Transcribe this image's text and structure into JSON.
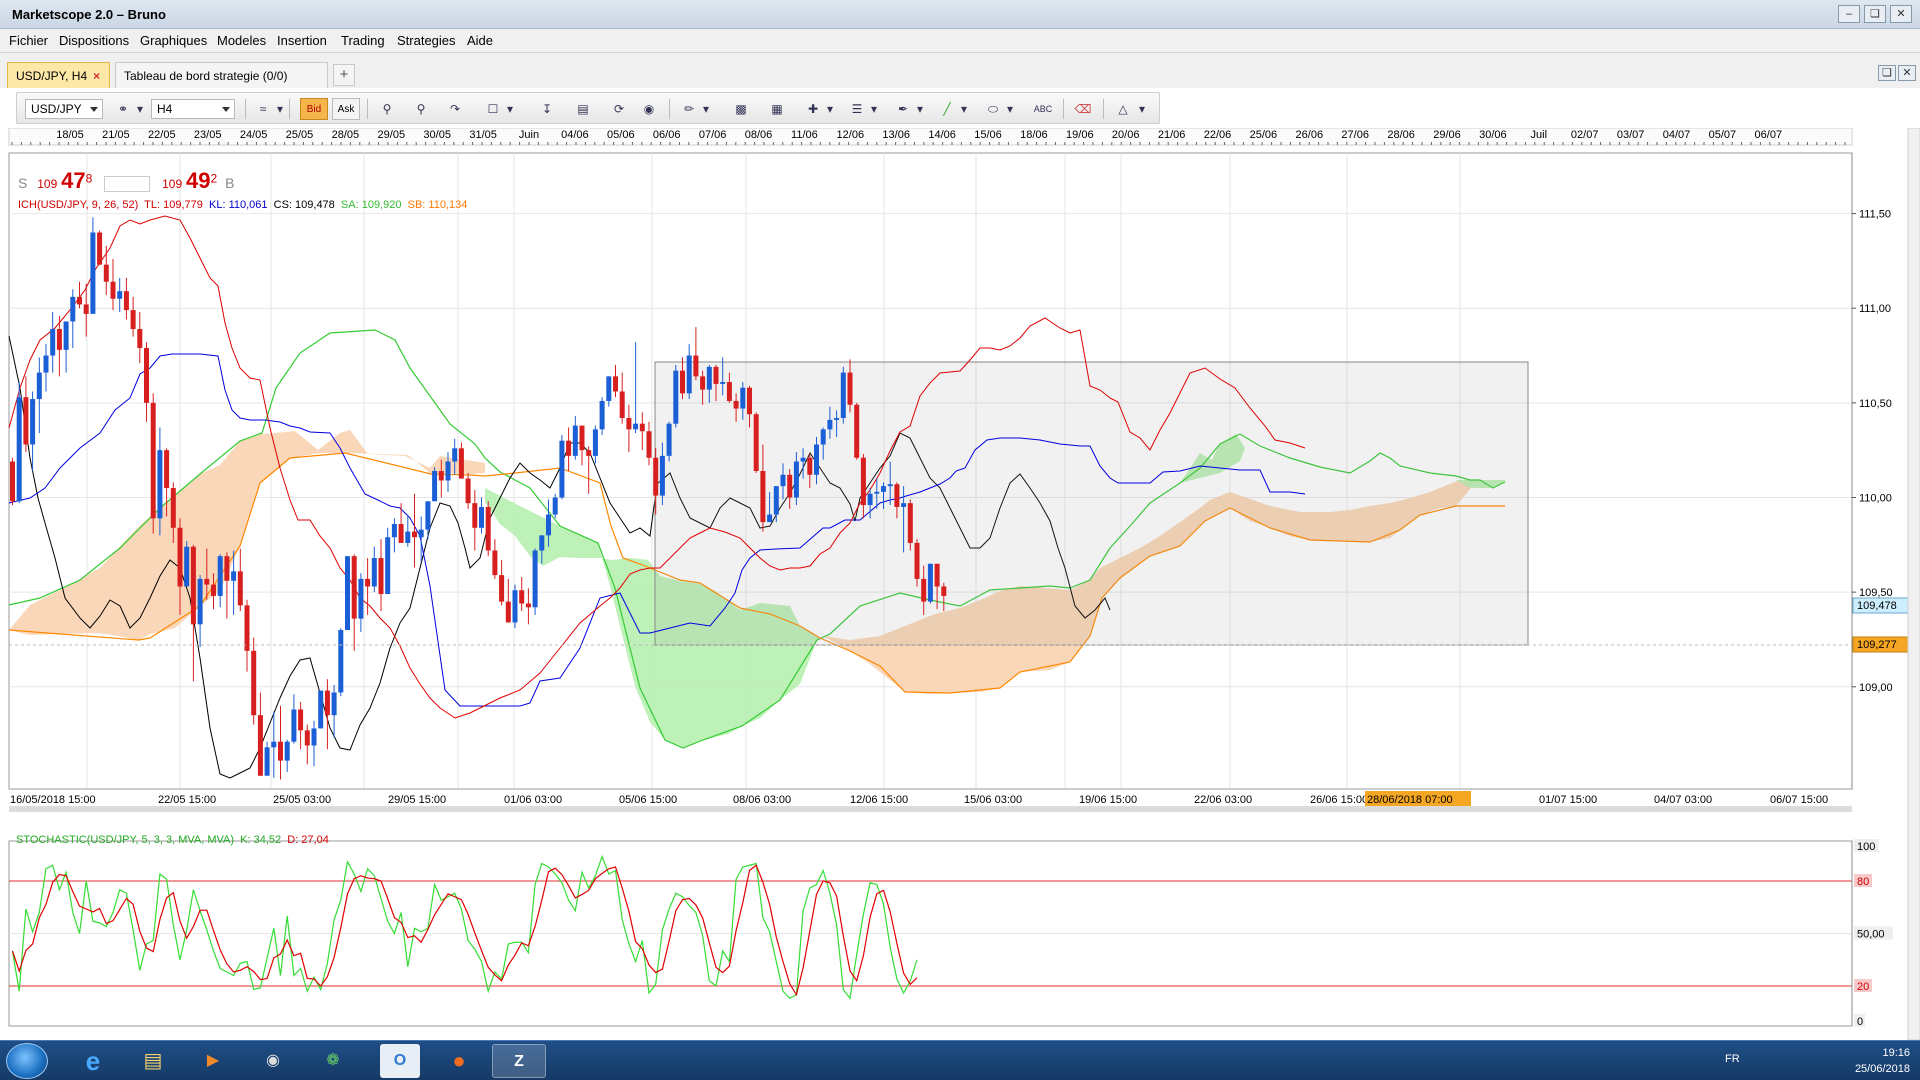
{
  "window": {
    "title": "Marketscope 2.0 – Bruno"
  },
  "menu": [
    "Fichier",
    "Dispositions",
    "Graphiques",
    "Modeles",
    "Insertion",
    "Trading",
    "Strategies",
    "Aide"
  ],
  "tabs": [
    {
      "label": "USD/JPY, H4",
      "active": true
    },
    {
      "label": "Tableau de bord strategie (0/0)",
      "active": false
    }
  ],
  "toolbar": {
    "symbol": "USD/JPY",
    "timeframe": "H4",
    "bid_label": "Bid",
    "ask_label": "Ask"
  },
  "quote": {
    "sell_label": "S",
    "sell_big_prefix": "109",
    "sell_pips": "47",
    "sell_frac": "8",
    "buy_big_prefix": "109",
    "buy_pips": "49",
    "buy_frac": "2",
    "buy_label": "B"
  },
  "ichimoku": {
    "name": "ICH(USD/JPY, 9, 26, 52)",
    "tl": "TL: 109,779",
    "kl": "KL: 110,061",
    "cs": "CS: 109,478",
    "sa": "SA: 109,920",
    "sb": "SB: 110,134",
    "colors": {
      "tenkan": "#e00000",
      "kijun": "#0000e0",
      "chikou": "#000000",
      "senkou_a": "#33cc33",
      "senkou_b": "#ff8800",
      "cloud_bull": "#b7f0b0",
      "cloud_bear": "#fad3b0"
    }
  },
  "stochastic": {
    "name": "STOCHASTIC(USD/JPY, 5, 3, 3, MVA, MVA)",
    "k": "K: 34,52",
    "d": "D: 27,04",
    "colors": {
      "k": "#33dd33",
      "d": "#e00000"
    }
  },
  "top_date_labels": [
    "18/05",
    "21/05",
    "22/05",
    "23/05",
    "24/05",
    "25/05",
    "28/05",
    "29/05",
    "30/05",
    "31/05",
    "Juin",
    "04/06",
    "05/06",
    "06/06",
    "07/06",
    "08/06",
    "11/06",
    "12/06",
    "13/06",
    "14/06",
    "15/06",
    "18/06",
    "19/06",
    "20/06",
    "21/06",
    "22/06",
    "25/06",
    "26/06",
    "27/06",
    "28/06",
    "29/06",
    "30/06",
    "Juil",
    "02/07",
    "03/07",
    "04/07",
    "05/07",
    "06/07"
  ],
  "bottom_date_labels": [
    "16/05/2018 15:00",
    "22/05 15:00",
    "25/05 03:00",
    "29/05 15:00",
    "01/06 03:00",
    "05/06 15:00",
    "08/06 03:00",
    "12/06 15:00",
    "15/06 03:00",
    "19/06 15:00",
    "22/06 03:00",
    "26/06 15:00",
    "28/06/2018 07:00",
    "01/07 15:00",
    "04/07 03:00",
    "06/07 15:00"
  ],
  "price_axis": {
    "labels": [
      "111,50",
      "111,00",
      "110,50",
      "110,00",
      "109,50",
      "109,00"
    ],
    "current_price": "109,478",
    "marker_price": "109,277"
  },
  "stoch_axis": {
    "labels": [
      "100",
      "80",
      "50,00",
      "20",
      "0"
    ]
  },
  "chart_data": {
    "type": "candlestick",
    "price_range": [
      108.46,
      111.82
    ],
    "candles": [
      [
        110.19,
        110.21,
        109.96,
        109.98
      ],
      [
        109.98,
        110.61,
        109.97,
        110.53
      ],
      [
        110.53,
        110.64,
        110.24,
        110.28
      ],
      [
        110.28,
        110.56,
        110.14,
        110.52
      ],
      [
        110.52,
        110.74,
        110.34,
        110.66
      ],
      [
        110.66,
        110.81,
        110.56,
        110.75
      ],
      [
        110.75,
        110.98,
        110.66,
        110.89
      ],
      [
        110.89,
        110.96,
        110.64,
        110.78
      ],
      [
        110.78,
        110.93,
        110.66,
        110.93
      ],
      [
        110.93,
        111.1,
        110.79,
        111.06
      ],
      [
        111.06,
        111.14,
        111.0,
        111.02
      ],
      [
        111.02,
        111.13,
        110.85,
        110.97
      ],
      [
        110.97,
        111.48,
        110.99,
        111.4
      ],
      [
        111.4,
        111.41,
        111.23,
        111.23
      ],
      [
        111.23,
        111.33,
        111.07,
        111.14
      ],
      [
        111.14,
        111.26,
        110.99,
        111.05
      ],
      [
        111.05,
        111.16,
        110.98,
        111.09
      ],
      [
        111.09,
        111.16,
        110.94,
        110.99
      ],
      [
        110.99,
        111.06,
        110.85,
        110.89
      ],
      [
        110.89,
        110.98,
        110.71,
        110.79
      ],
      [
        110.79,
        110.82,
        110.4,
        110.5
      ],
      [
        110.5,
        110.55,
        109.81,
        109.89
      ],
      [
        109.89,
        110.37,
        109.8,
        110.25
      ],
      [
        110.25,
        110.26,
        109.9,
        110.05
      ],
      [
        110.05,
        110.08,
        109.76,
        109.84
      ],
      [
        109.84,
        109.89,
        109.38,
        109.53
      ],
      [
        109.53,
        109.77,
        109.53,
        109.74
      ],
      [
        109.74,
        109.75,
        109.03,
        109.33
      ],
      [
        109.33,
        109.59,
        109.21,
        109.57
      ],
      [
        109.57,
        109.73,
        109.46,
        109.54
      ],
      [
        109.54,
        109.6,
        109.41,
        109.48
      ],
      [
        109.48,
        109.7,
        109.42,
        109.69
      ],
      [
        109.69,
        109.71,
        109.36,
        109.56
      ],
      [
        109.56,
        109.72,
        109.38,
        109.61
      ],
      [
        109.61,
        109.73,
        109.4,
        109.43
      ],
      [
        109.43,
        109.46,
        109.08,
        109.19
      ],
      [
        109.19,
        109.26,
        108.8,
        108.85
      ],
      [
        108.85,
        108.97,
        108.53,
        108.53
      ],
      [
        108.53,
        108.71,
        108.54,
        108.68
      ],
      [
        108.68,
        108.87,
        108.52,
        108.71
      ],
      [
        108.71,
        108.9,
        108.51,
        108.61
      ],
      [
        108.61,
        108.72,
        108.55,
        108.71
      ],
      [
        108.71,
        108.96,
        108.7,
        108.88
      ],
      [
        108.88,
        108.92,
        108.67,
        108.77
      ],
      [
        108.77,
        108.8,
        108.59,
        108.69
      ],
      [
        108.69,
        108.82,
        108.58,
        108.78
      ],
      [
        108.78,
        108.98,
        108.78,
        108.98
      ],
      [
        108.98,
        109.04,
        108.67,
        108.85
      ],
      [
        108.85,
        109.01,
        108.73,
        108.97
      ],
      [
        108.97,
        109.31,
        108.95,
        109.3
      ],
      [
        109.3,
        109.69,
        109.3,
        109.69
      ],
      [
        109.69,
        109.7,
        109.19,
        109.36
      ],
      [
        109.36,
        109.6,
        109.29,
        109.57
      ],
      [
        109.57,
        109.68,
        109.38,
        109.53
      ],
      [
        109.53,
        109.74,
        109.5,
        109.68
      ],
      [
        109.68,
        109.78,
        109.4,
        109.49
      ],
      [
        109.49,
        109.84,
        109.49,
        109.79
      ],
      [
        109.79,
        109.89,
        109.71,
        109.86
      ],
      [
        109.86,
        109.97,
        109.76,
        109.76
      ],
      [
        109.76,
        109.91,
        109.74,
        109.82
      ],
      [
        109.82,
        110.02,
        109.63,
        109.79
      ],
      [
        109.79,
        109.9,
        109.66,
        109.83
      ],
      [
        109.83,
        109.98,
        109.78,
        109.98
      ],
      [
        109.98,
        110.16,
        109.99,
        110.14
      ],
      [
        110.14,
        110.2,
        110.0,
        110.09
      ],
      [
        110.09,
        110.24,
        110.03,
        110.19
      ],
      [
        110.19,
        110.31,
        110.12,
        110.26
      ],
      [
        110.26,
        110.29,
        110.1,
        110.1
      ],
      [
        110.1,
        110.13,
        109.94,
        109.97
      ],
      [
        109.97,
        110.04,
        109.72,
        109.84
      ],
      [
        109.84,
        110.0,
        109.81,
        109.95
      ],
      [
        109.95,
        109.98,
        109.69,
        109.72
      ],
      [
        109.72,
        109.78,
        109.57,
        109.59
      ],
      [
        109.59,
        109.67,
        109.43,
        109.45
      ],
      [
        109.45,
        109.57,
        109.34,
        109.34
      ],
      [
        109.34,
        109.54,
        109.31,
        109.51
      ],
      [
        109.51,
        109.58,
        109.4,
        109.44
      ],
      [
        109.44,
        109.52,
        109.33,
        109.42
      ],
      [
        109.42,
        109.73,
        109.38,
        109.72
      ],
      [
        109.72,
        109.8,
        109.65,
        109.8
      ],
      [
        109.8,
        109.99,
        109.74,
        109.91
      ],
      [
        109.91,
        110.02,
        109.89,
        110.0
      ],
      [
        110.0,
        110.33,
        109.99,
        110.3
      ],
      [
        110.3,
        110.37,
        110.14,
        110.22
      ],
      [
        110.22,
        110.43,
        110.2,
        110.38
      ],
      [
        110.38,
        110.38,
        110.17,
        110.25
      ],
      [
        110.25,
        110.27,
        110.02,
        110.22
      ],
      [
        110.22,
        110.38,
        110.18,
        110.36
      ],
      [
        110.36,
        110.53,
        110.33,
        110.51
      ],
      [
        110.51,
        110.64,
        110.48,
        110.64
      ],
      [
        110.64,
        110.7,
        110.53,
        110.56
      ],
      [
        110.56,
        110.66,
        110.39,
        110.42
      ],
      [
        110.42,
        110.49,
        110.24,
        110.36
      ],
      [
        110.36,
        110.82,
        110.34,
        110.39
      ],
      [
        110.39,
        110.45,
        110.25,
        110.35
      ],
      [
        110.35,
        110.4,
        110.17,
        110.21
      ],
      [
        110.21,
        110.26,
        109.91,
        110.01
      ],
      [
        110.01,
        110.29,
        109.96,
        110.22
      ],
      [
        110.22,
        110.4,
        110.19,
        110.39
      ],
      [
        110.39,
        110.7,
        110.37,
        110.67
      ],
      [
        110.67,
        110.74,
        110.52,
        110.55
      ],
      [
        110.55,
        110.81,
        110.52,
        110.75
      ],
      [
        110.75,
        110.9,
        110.62,
        110.64
      ],
      [
        110.64,
        110.67,
        110.49,
        110.57
      ],
      [
        110.57,
        110.7,
        110.5,
        110.69
      ],
      [
        110.69,
        110.7,
        110.51,
        110.6
      ],
      [
        110.6,
        110.74,
        110.54,
        110.61
      ],
      [
        110.61,
        110.66,
        110.5,
        110.51
      ],
      [
        110.51,
        110.55,
        110.4,
        110.47
      ],
      [
        110.47,
        110.61,
        110.41,
        110.58
      ],
      [
        110.58,
        110.59,
        110.37,
        110.44
      ],
      [
        110.44,
        110.45,
        110.13,
        110.14
      ],
      [
        110.14,
        110.28,
        109.82,
        109.87
      ],
      [
        109.87,
        110.03,
        109.88,
        109.91
      ],
      [
        109.91,
        110.06,
        109.87,
        110.06
      ],
      [
        110.06,
        110.18,
        109.99,
        110.12
      ],
      [
        110.12,
        110.15,
        109.94,
        110.0
      ],
      [
        110.0,
        110.24,
        109.96,
        110.19
      ],
      [
        110.19,
        110.26,
        110.1,
        110.21
      ],
      [
        110.21,
        110.23,
        110.05,
        110.12
      ],
      [
        110.12,
        110.32,
        110.07,
        110.28
      ],
      [
        110.28,
        110.37,
        110.2,
        110.36
      ],
      [
        110.36,
        110.48,
        110.31,
        110.41
      ],
      [
        110.41,
        110.46,
        110.32,
        110.42
      ],
      [
        110.42,
        110.69,
        110.39,
        110.66
      ],
      [
        110.66,
        110.73,
        110.45,
        110.49
      ],
      [
        110.49,
        110.5,
        110.2,
        110.21
      ],
      [
        110.21,
        110.23,
        109.89,
        109.96
      ],
      [
        109.96,
        110.05,
        109.89,
        110.02
      ],
      [
        110.02,
        110.1,
        109.94,
        110.03
      ],
      [
        110.03,
        110.08,
        109.94,
        110.06
      ],
      [
        110.06,
        110.19,
        109.96,
        110.07
      ],
      [
        110.07,
        110.08,
        109.89,
        109.95
      ],
      [
        109.95,
        110.06,
        109.71,
        109.97
      ],
      [
        109.97,
        109.99,
        109.72,
        109.76
      ],
      [
        109.76,
        109.78,
        109.53,
        109.57
      ],
      [
        109.57,
        109.64,
        109.38,
        109.45
      ],
      [
        109.45,
        109.65,
        109.44,
        109.65
      ],
      [
        109.65,
        109.64,
        109.41,
        109.53
      ],
      [
        109.53,
        109.55,
        109.4,
        109.48
      ]
    ],
    "stochastic_k": [
      40,
      17,
      64,
      51,
      62,
      87,
      89,
      75,
      85,
      62,
      50,
      80,
      57,
      56,
      54,
      62,
      75,
      73,
      52,
      29,
      44,
      46,
      84,
      81,
      55,
      35,
      52,
      75,
      63,
      52,
      40,
      30,
      28,
      26,
      33,
      34,
      18,
      19,
      36,
      53,
      26,
      60,
      26,
      30,
      17,
      25,
      18,
      33,
      58,
      69,
      91,
      84,
      74,
      87,
      83,
      70,
      57,
      50,
      62,
      31,
      53,
      51,
      53,
      78,
      69,
      71,
      73,
      64,
      46,
      41,
      34,
      17,
      28,
      24,
      44,
      45,
      45,
      39,
      78,
      90,
      88,
      84,
      79,
      69,
      63,
      85,
      76,
      83,
      94,
      84,
      86,
      58,
      44,
      34,
      46,
      16,
      21,
      52,
      64,
      73,
      71,
      66,
      62,
      49,
      23,
      20,
      40,
      34,
      81,
      88,
      89,
      90,
      59,
      51,
      34,
      17,
      13,
      15,
      63,
      76,
      78,
      86,
      73,
      55,
      18,
      13,
      38,
      61,
      79,
      78,
      67,
      42,
      24,
      16,
      23,
      35
    ]
  }
}
